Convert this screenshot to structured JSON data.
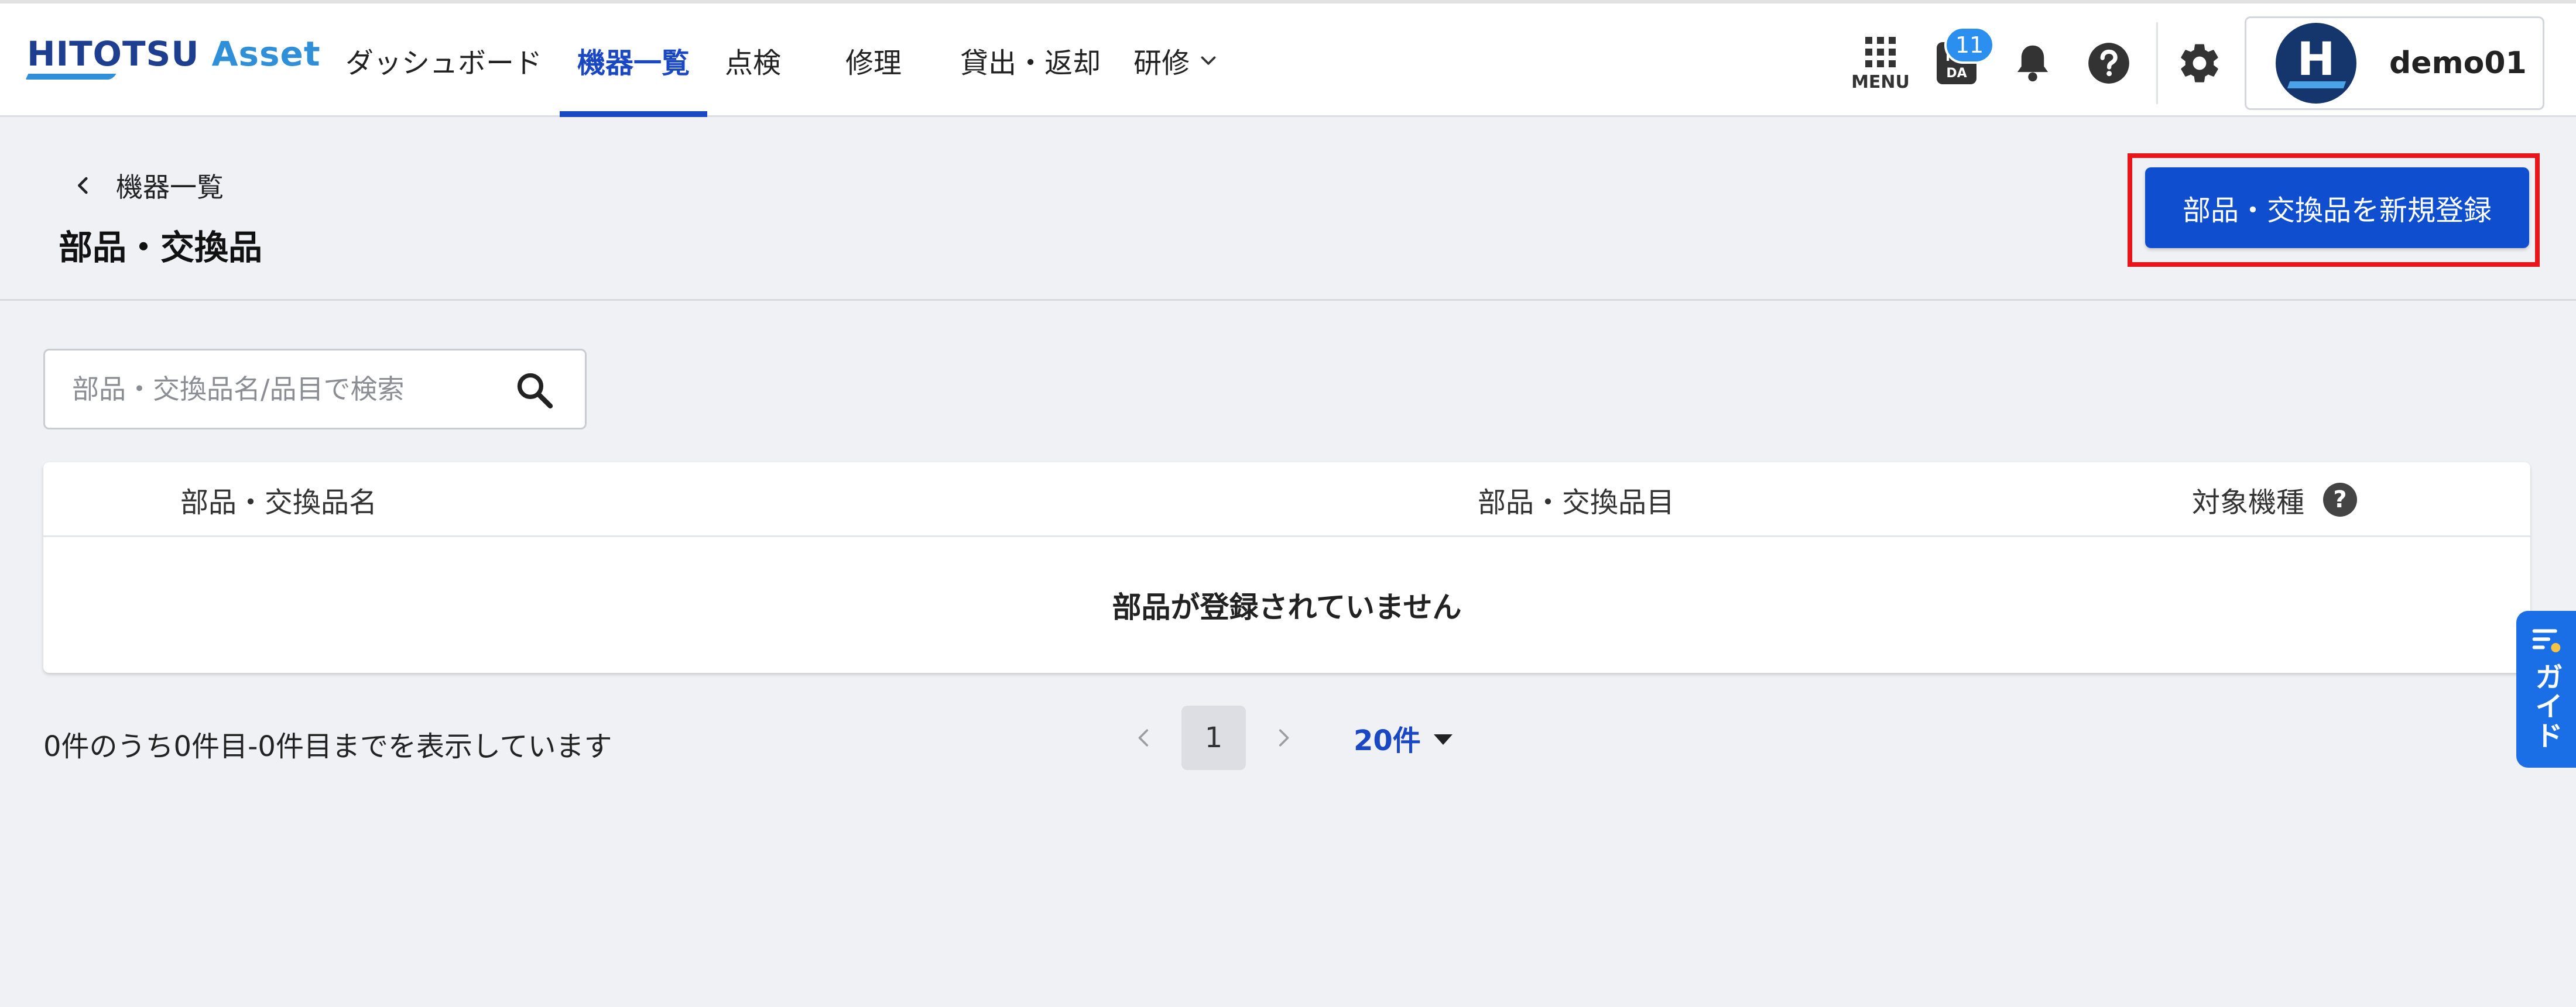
{
  "header": {
    "logo_main": "HITOTSU ",
    "logo_accent": "Asset",
    "nav": [
      {
        "label": "ダッシュボード",
        "active": false
      },
      {
        "label": "機器一覧",
        "active": true
      },
      {
        "label": "点検",
        "active": false
      },
      {
        "label": "修理",
        "active": false
      },
      {
        "label": "貸出・返却",
        "active": false
      },
      {
        "label": "研修",
        "active": false
      }
    ],
    "menu_label": "MENU",
    "pmda_label": "PMDA",
    "pmda_count": "11",
    "user_initial": "H",
    "user_name": "demo01"
  },
  "page": {
    "back_label": "機器一覧",
    "title": "部品・交換品",
    "register_button": "部品・交換品を新規登録"
  },
  "search": {
    "placeholder": "部品・交換品名/品目で検索",
    "value": ""
  },
  "table": {
    "columns": [
      "部品・交換品名",
      "部品・交換品目",
      "対象機種"
    ],
    "help_glyph": "?",
    "empty_message": "部品が登録されていません"
  },
  "pagination": {
    "summary": "0件のうち0件目-0件目までを表示しています",
    "current_page": "1",
    "per_page": "20件"
  },
  "guide": {
    "label": "ガイド"
  },
  "colors": {
    "primary": "#0f4fcf",
    "nav_active": "#1a48c4",
    "highlight": "#e8151b",
    "badge": "#2b8ff0",
    "guide": "#1a6fe6",
    "background": "#f0f1f5"
  },
  "icons": [
    "apps-grid-icon",
    "pmda-icon",
    "bell-icon",
    "help-circle-icon",
    "gear-icon",
    "chevron-left-icon",
    "chevron-right-icon",
    "chevron-down-icon",
    "search-icon",
    "guide-icon"
  ]
}
